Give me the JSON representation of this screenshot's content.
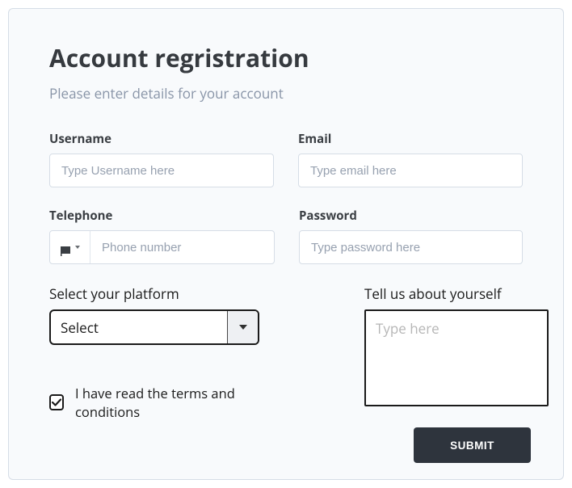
{
  "title": "Account regristration",
  "subtitle": "Please enter details for your account",
  "fields": {
    "username": {
      "label": "Username",
      "placeholder": "Type Username here",
      "value": ""
    },
    "email": {
      "label": "Email",
      "placeholder": "Type email here",
      "value": ""
    },
    "telephone": {
      "label": "Telephone",
      "placeholder": "Phone number",
      "value": ""
    },
    "password": {
      "label": "Password",
      "placeholder": "Type password here",
      "value": ""
    }
  },
  "platform": {
    "label": "Select your platform",
    "value": "Select"
  },
  "about": {
    "label": "Tell us about yourself",
    "placeholder": "Type here",
    "value": ""
  },
  "terms": {
    "label": "I have read the terms and conditions",
    "checked": true
  },
  "submit_label": "SUBMIT"
}
